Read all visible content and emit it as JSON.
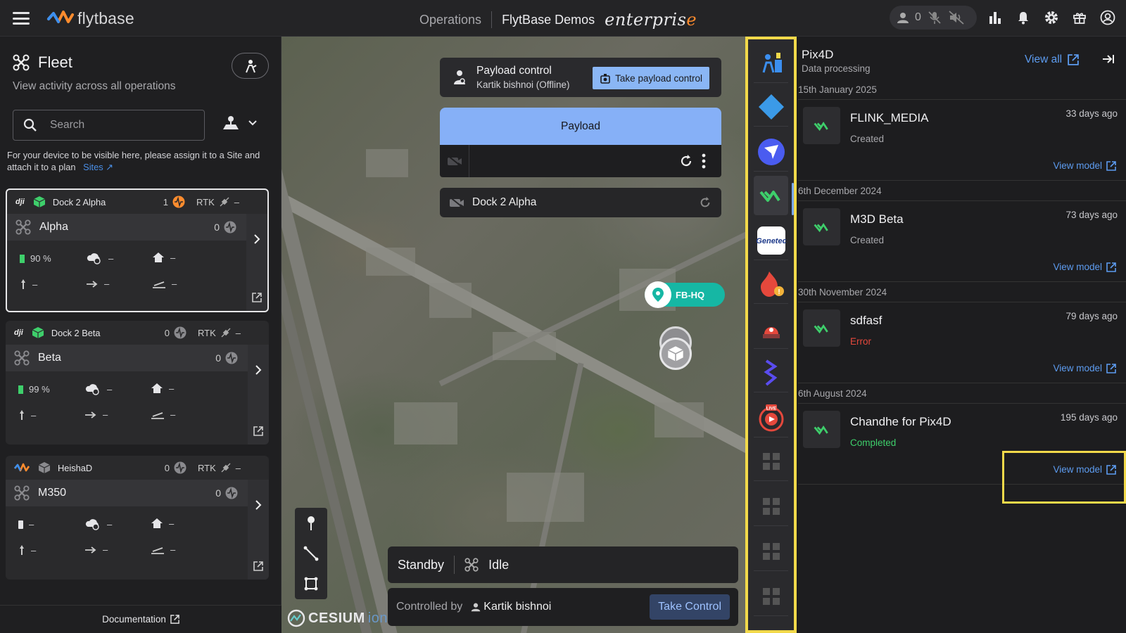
{
  "header": {
    "logo_text": "flytbase",
    "nav_operations": "Operations",
    "org_name": "FlytBase Demos",
    "edition": "enterpris",
    "edition_accent": "e",
    "presence_count": "0"
  },
  "fleet": {
    "title": "Fleet",
    "subtitle": "View activity across all operations",
    "search_placeholder": "Search",
    "hint": "For your device to be visible here, please assign it to a Site and attach it to a plan",
    "hint_link": "Sites",
    "documentation": "Documentation",
    "cards": [
      {
        "dock": "Dock 2 Alpha",
        "dock_count": "1",
        "rtk": "RTK",
        "rtk_val": "–",
        "drone": "Alpha",
        "drone_count": "0",
        "battery": "90 %",
        "weather": "–",
        "home": "–",
        "altitude": "–",
        "speed": "–",
        "landing": "–"
      },
      {
        "dock": "Dock 2 Beta",
        "dock_count": "0",
        "rtk": "RTK",
        "rtk_val": "–",
        "drone": "Beta",
        "drone_count": "0",
        "battery": "99 %",
        "weather": "–",
        "home": "–",
        "altitude": "–",
        "speed": "–",
        "landing": "–"
      },
      {
        "dock": "HeishaD",
        "dock_count": "0",
        "rtk": "RTK",
        "rtk_val": "–",
        "drone": "M350",
        "drone_count": "0",
        "battery": "–",
        "weather": "–",
        "home": "–",
        "altitude": "–",
        "speed": "–",
        "landing": "–"
      }
    ]
  },
  "map": {
    "payload_control_title": "Payload control",
    "payload_control_user": "Kartik bishnoi (Offline)",
    "take_payload_control": "Take payload control",
    "payload_label": "Payload",
    "dock_camera": "Dock 2 Alpha",
    "site_marker": "FB-HQ",
    "status_left": "Standby",
    "status_right": "Idle",
    "controlled_by_label": "Controlled by",
    "controlled_by_user": "Kartik bishnoi",
    "take_control": "Take Control",
    "cesium": "CESIUM",
    "cesium_suffix": "ion"
  },
  "pix4d": {
    "title": "Pix4D",
    "subtitle": "Data processing",
    "view_all": "View all",
    "groups": [
      {
        "date": "15th January 2025",
        "name": "FLINK_MEDIA",
        "state": "Created",
        "ago": "33 days ago",
        "view": "View model"
      },
      {
        "date": "6th December 2024",
        "name": "M3D Beta",
        "state": "Created",
        "ago": "73 days ago",
        "view": "View model"
      },
      {
        "date": "30th November 2024",
        "name": "sdfasf",
        "state": "Error",
        "ago": "79 days ago",
        "view": "View model"
      },
      {
        "date": "6th August 2024",
        "name": "Chandhe for Pix4D",
        "state": "Completed",
        "ago": "195 days ago",
        "view": "View model"
      }
    ]
  },
  "colors": {
    "accent_blue": "#5d9cf0",
    "highlight_yellow": "#f2d94a",
    "error_red": "#e5483c",
    "success_green": "#3ecf6b",
    "teal_marker": "#16b7a4"
  }
}
